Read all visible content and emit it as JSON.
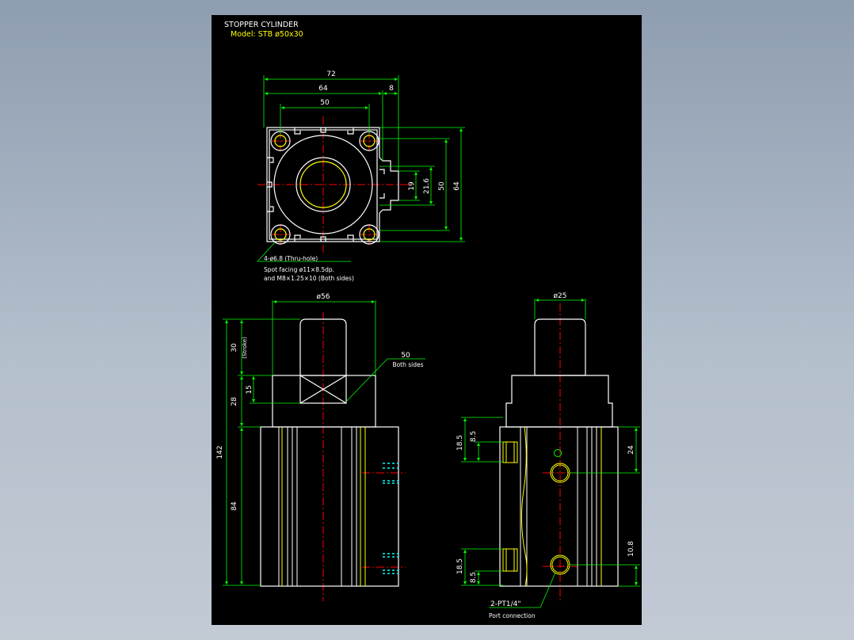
{
  "title": {
    "line1": "STOPPER CYLINDER",
    "line2": "Model: STB ø50x30"
  },
  "colors": {
    "background": "#000000",
    "outline": "#ffffff",
    "dimension": "#00ff00",
    "centerline": "#ff0000",
    "hidden": "#00ffff",
    "detail": "#ffff00",
    "text": "#ffffff"
  },
  "top_view": {
    "dims": {
      "overall_width": "72",
      "body_width": "64",
      "port_offset": "8",
      "hole_pitch": "50",
      "height_19": "19",
      "height_21_6": "21.6",
      "height_50": "50",
      "height_64": "64"
    },
    "notes": {
      "holes": "4-ø6.8  (Thru-hole)",
      "spot": "Spot facing ø11×8.5dp.",
      "thread": "and M8×1.25×10 (Both sides)"
    }
  },
  "front_view": {
    "dims": {
      "rod_dia": "ø56",
      "stroke": "30",
      "stroke_note": "(Stroke)",
      "head_h": "28",
      "flat_h": "15",
      "overall_h": "142",
      "body_h": "84",
      "flats": "50",
      "flats_note": "Both sides"
    }
  },
  "side_view": {
    "dims": {
      "rod_dia": "ø25",
      "upper_18_5": "18.5",
      "upper_8_5": "8.5",
      "lower_18_5": "18.5",
      "lower_8_5": "8.5",
      "right_24": "24",
      "right_10_8": "10.8"
    },
    "notes": {
      "port": "2-PT1/4\"",
      "port_note": "Port connection"
    }
  }
}
